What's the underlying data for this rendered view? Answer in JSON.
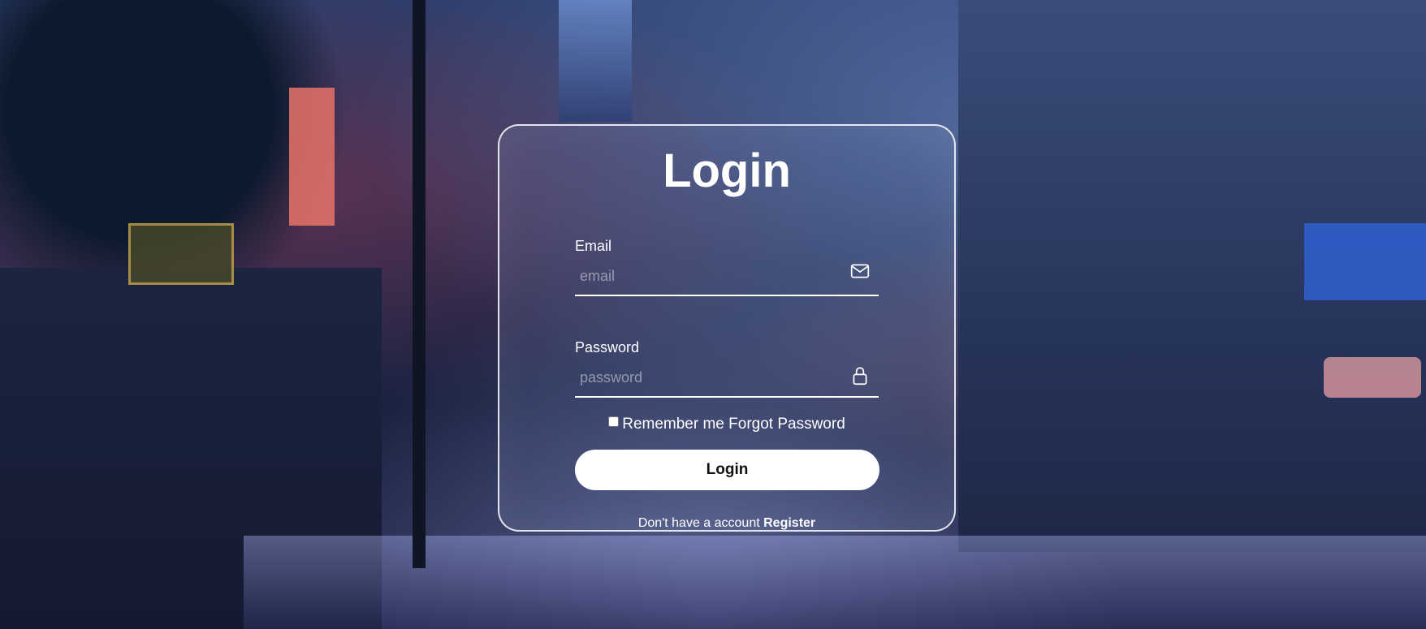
{
  "login_form": {
    "title": "Login",
    "email_label": "Email",
    "email_placeholder": "email",
    "email_value": "",
    "password_label": "Password",
    "password_placeholder": "password",
    "password_value": "",
    "remember_label": "Remember me",
    "remember_checked": false,
    "forgot_label": "Forgot Password",
    "submit_label": "Login",
    "register_prompt": "Don't have a account",
    "register_label": "Register"
  },
  "icons": {
    "email": "envelope-icon",
    "password": "lock-icon"
  },
  "colors": {
    "card_border": "#ffffff",
    "button_bg": "#ffffff",
    "button_text": "#111111",
    "text": "#ffffff"
  }
}
